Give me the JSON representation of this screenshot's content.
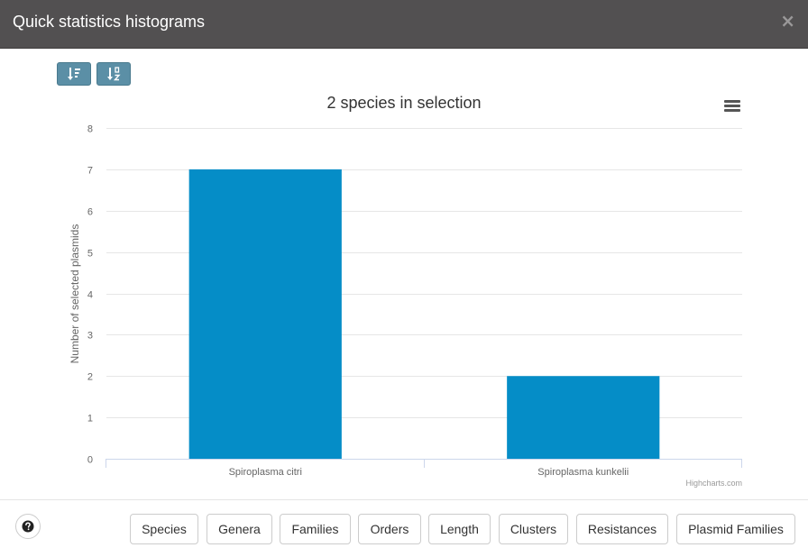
{
  "dialog": {
    "title": "Quick statistics histograms",
    "close_icon": "×"
  },
  "toolbar": {
    "sort_desc_icon": "sort-amount-desc-icon",
    "sort_alpha_icon": "sort-alpha-icon"
  },
  "chart_data": {
    "type": "bar",
    "title": "2 species in selection",
    "xlabel": "",
    "ylabel": "Number of selected plasmids",
    "categories": [
      "Spiroplasma citri",
      "Spiroplasma kunkelii"
    ],
    "values": [
      7,
      2
    ],
    "ylim": [
      0,
      8
    ],
    "yticks": [
      "0",
      "1",
      "2",
      "3",
      "4",
      "5",
      "6",
      "7",
      "8"
    ],
    "color": "#058dc7",
    "grid": true,
    "credits": "Highcharts.com"
  },
  "footer": {
    "buttons": [
      "Species",
      "Genera",
      "Families",
      "Orders",
      "Length",
      "Clusters",
      "Resistances",
      "Plasmid Families"
    ]
  }
}
